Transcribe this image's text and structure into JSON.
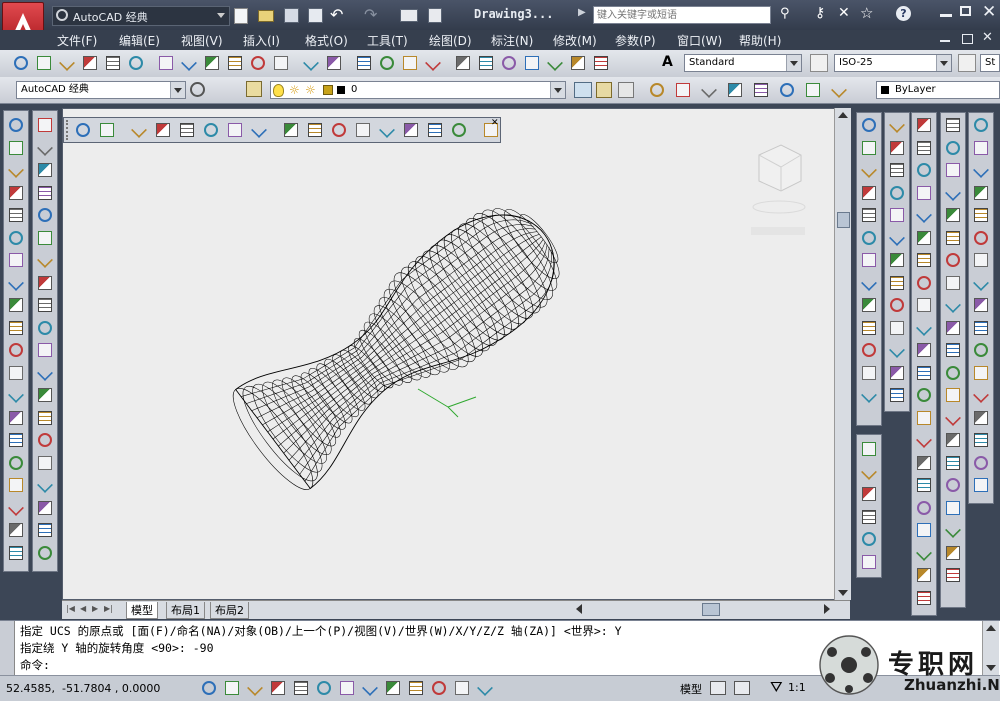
{
  "title_bar": {
    "workspace": "AutoCAD 经典",
    "document_title": "Drawing3...",
    "search_placeholder": "键入关键字或短语"
  },
  "menu": [
    "文件(F)",
    "编辑(E)",
    "视图(V)",
    "插入(I)",
    "格式(O)",
    "工具(T)",
    "绘图(D)",
    "标注(N)",
    "修改(M)",
    "参数(P)",
    "窗口(W)",
    "帮助(H)"
  ],
  "styles": {
    "text_style": "Standard",
    "dim_style": "ISO-25",
    "table_style_partial": "St"
  },
  "workspace_combo": "AutoCAD 经典",
  "layer": {
    "current": "0"
  },
  "color_combo": "ByLayer",
  "layout_tabs": [
    "模型",
    "布局1",
    "布局2"
  ],
  "command_history": [
    "指定 UCS 的原点或 [面(F)/命名(NA)/对象(OB)/上一个(P)/视图(V)/世界(W)/X/Y/Z/Z 轴(ZA)] <世界>: Y",
    "指定绕 Y 轴的旋转角度 <90>: -90"
  ],
  "command_prompt": "命令:",
  "status_bar": {
    "coordinates": "52.4585,  -51.7804 , 0.0000",
    "model_label": "模型",
    "annotation_scale": "1:1"
  },
  "watermark": {
    "brand": "专职网",
    "url": "Zhuanzhi.Net"
  },
  "colors": {
    "canvas": "#ededed",
    "chrome_dark": "#3c4656",
    "toolbar": "#d3d7de",
    "accent_red": "#c8282d"
  }
}
